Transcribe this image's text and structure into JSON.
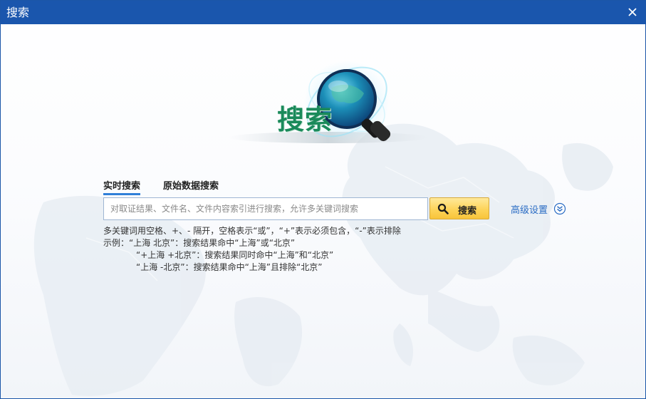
{
  "window": {
    "title": "搜索"
  },
  "colors": {
    "titlebar": "#1a56ad",
    "accent": "#2f7fd8",
    "link": "#2a6cc4",
    "button": "#fdd45a",
    "logo_text": "#1a8a5a"
  },
  "logo": {
    "text": "搜索",
    "icon": "magnifier-globe-icon"
  },
  "tabs": [
    {
      "label": "实时搜索",
      "active": true
    },
    {
      "label": "原始数据搜索",
      "active": false
    }
  ],
  "search": {
    "placeholder": "对取证结果、文件名、文件内容索引进行搜索，允许多关键词搜索",
    "value": "",
    "button_label": "搜索",
    "button_icon": "search-icon"
  },
  "advanced": {
    "label": "高级设置",
    "toggle_icon": "double-chevron-down-icon"
  },
  "help": {
    "rule": "多关键词用空格、+、- 隔开，空格表示“或”，“+”表示必须包含，“-”表示排除",
    "example_label": "示例：",
    "examples": [
      "“上海 北京”：搜索结果命中“上海”或“北京”",
      "“+上海 +北京”：搜索结果同时命中“上海”和“北京”",
      "“上海 -北京”：搜索结果命中“上海”且排除“北京”"
    ]
  }
}
